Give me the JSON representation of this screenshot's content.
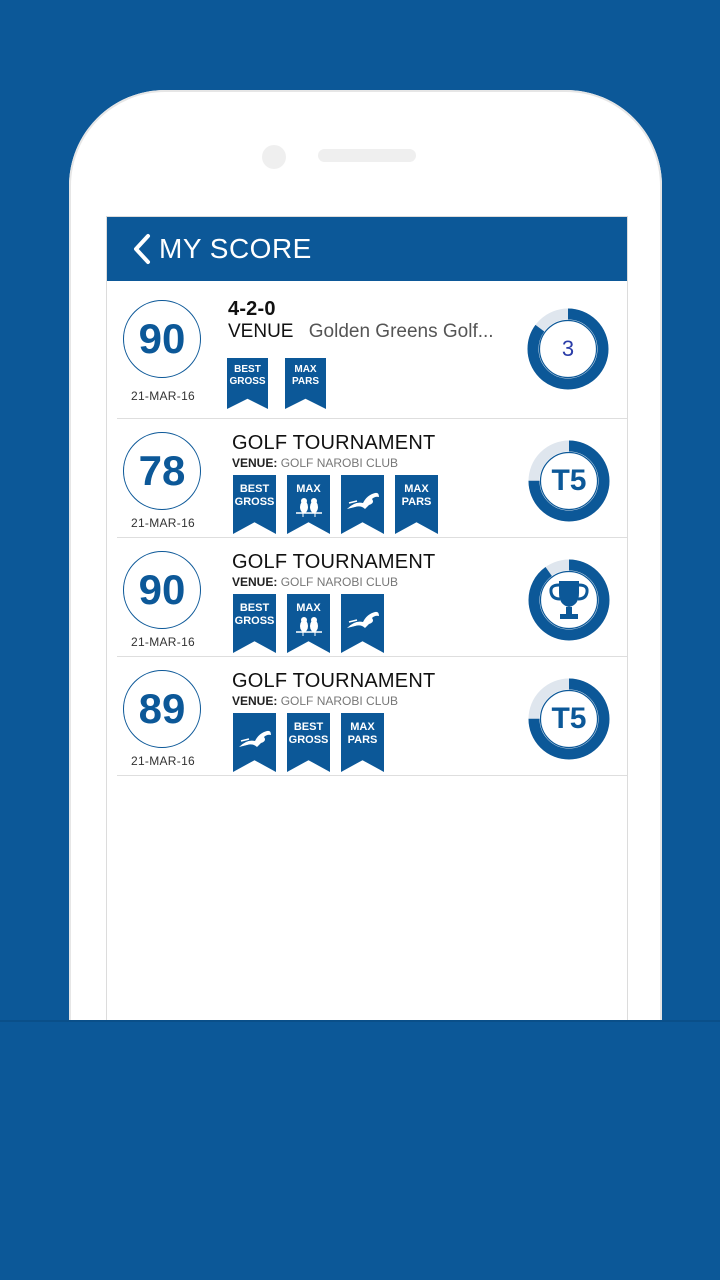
{
  "header": {
    "title": "MY SCORE"
  },
  "scores": [
    {
      "score": "90",
      "date": "21-MAR-16",
      "title": "4-2-0",
      "venue_label": "VENUE",
      "venue": "Golden Greens Golf...",
      "badges": [
        "BEST GROSS",
        "MAX PARS"
      ],
      "rank": "3",
      "rank_fill": 0.85
    },
    {
      "score": "78",
      "date": "21-MAR-16",
      "title": "GOLF TOURNAMENT",
      "venue_label": "VENUE:",
      "venue": "GOLF NAROBI CLUB",
      "badges": [
        "BEST GROSS",
        "MAX",
        "",
        "MAX PARS"
      ],
      "rank": "T5",
      "rank_fill": 0.75
    },
    {
      "score": "90",
      "date": "21-MAR-16",
      "title": "GOLF TOURNAMENT",
      "venue_label": "VENUE:",
      "venue": "GOLF NAROBI CLUB",
      "badges": [
        "BEST GROSS",
        "MAX",
        ""
      ],
      "rank": "trophy",
      "rank_fill": 0.9
    },
    {
      "score": "89",
      "date": "21-MAR-16",
      "title": "GOLF TOURNAMENT",
      "venue_label": "VENUE:",
      "venue": "GOLF NAROBI CLUB",
      "badges": [
        "",
        "BEST GROSS",
        "MAX PARS"
      ],
      "rank": "T5",
      "rank_fill": 0.75
    }
  ],
  "colors": {
    "brand": "#0c5898",
    "rank_text_first": "#2a3ca8"
  }
}
